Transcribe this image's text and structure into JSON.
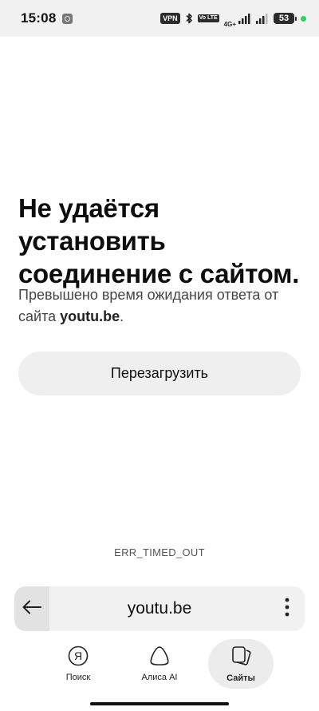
{
  "status": {
    "time": "15:08",
    "vpn": "VPN",
    "volte": "Vo LTE",
    "network": "4G+",
    "battery": "53"
  },
  "error": {
    "title": "Не удаётся установить соединение с сайтом.",
    "desc_prefix": "Превышено время ожидания ответа от сайта ",
    "desc_site": "youtu.be",
    "desc_suffix": ".",
    "reload_label": "Перезагрузить",
    "code": "ERR_TIMED_OUT"
  },
  "address_bar": {
    "url": "youtu.be"
  },
  "nav": {
    "search_label": "Поиск",
    "alice_label": "Алиса AI",
    "sites_label": "Сайты",
    "search_icon_glyph": "Я"
  }
}
